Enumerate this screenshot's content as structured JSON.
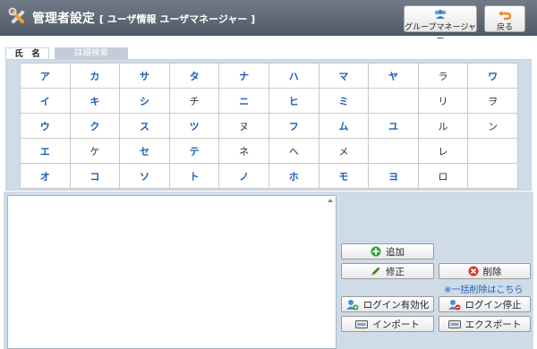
{
  "header": {
    "title": "管理者設定",
    "subtitle": "[ ユーザ情報 ユーザマネージャー ]",
    "group_manager_label": "グループマネージャー",
    "back_label": "戻る"
  },
  "tabs": {
    "name": "氏　名",
    "detail": "詳細検索"
  },
  "kana_rows": [
    [
      "ア",
      "カ",
      "サ",
      "タ",
      "ナ",
      "ハ",
      "マ",
      "ヤ",
      "ラ",
      "ワ"
    ],
    [
      "イ",
      "キ",
      "シ",
      "チ",
      "ニ",
      "ヒ",
      "ミ",
      "",
      "リ",
      "ヲ"
    ],
    [
      "ウ",
      "ク",
      "ス",
      "ツ",
      "ヌ",
      "フ",
      "ム",
      "ユ",
      "ル",
      "ン"
    ],
    [
      "エ",
      "ケ",
      "セ",
      "テ",
      "ネ",
      "ヘ",
      "メ",
      "",
      "レ",
      ""
    ],
    [
      "オ",
      "コ",
      "ソ",
      "ト",
      "ノ",
      "ホ",
      "モ",
      "ヨ",
      "ロ",
      ""
    ]
  ],
  "kana_disabled": [
    "チ",
    "ヌ",
    "ネ",
    "ヘ",
    "メ",
    "ラ",
    "リ",
    "ヲ",
    "ル",
    "ン",
    "レ",
    "ロ",
    "ケ"
  ],
  "actions": {
    "add": "追加",
    "edit": "修正",
    "delete": "削除",
    "bulk_delete_link": "※一括削除はこちら",
    "login_enable": "ログイン有効化",
    "login_disable": "ログイン停止",
    "import": "インポート",
    "export": "エクスポート"
  },
  "colors": {
    "header": "#5f6a76",
    "panel": "#cfdce8",
    "kana_active": "#1a5fb4",
    "link": "#2060c0"
  }
}
